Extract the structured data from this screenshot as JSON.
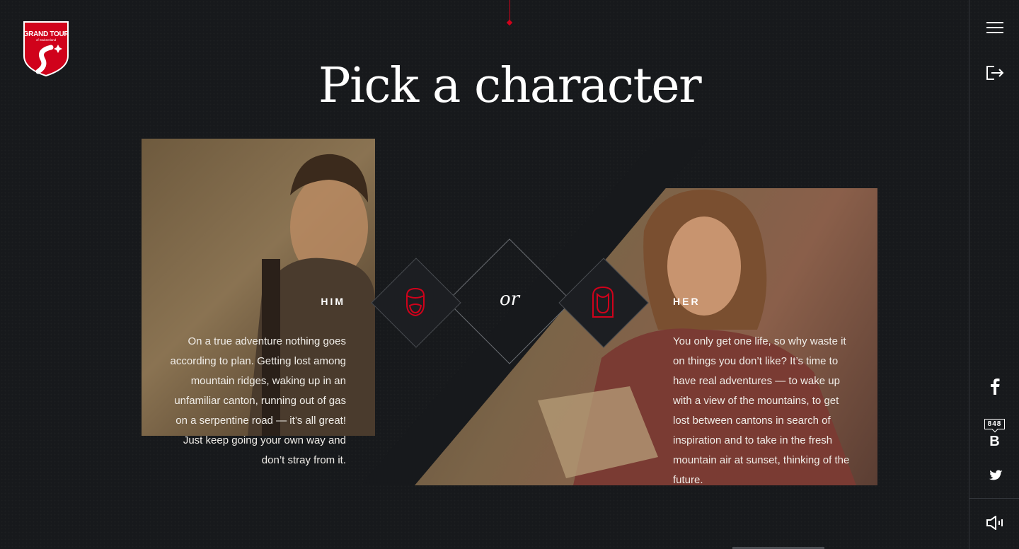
{
  "logo": {
    "line1": "GRAND TOUR",
    "line2": "of Switzerland",
    "color": "#d0021b"
  },
  "page_title": "Pick a character",
  "or_label": "or",
  "him": {
    "label": "HIM",
    "description": "On a true adventure nothing goes according to plan. Getting lost among mountain ridges, waking up in an unfamiliar canton, running out of gas on a serpentine road — it’s all great! Just keep going your own way and don’t stray from it.",
    "icon": "male-face-icon"
  },
  "her": {
    "label": "HER",
    "description": "You only get one life, so why waste it on things you don’t like? It’s time to have real adventures — to wake up with a view of the mountains, to get lost between cantons in search of inspiration and to take in the fresh mountain air at sunset, thinking of the future.",
    "icon": "female-face-icon"
  },
  "rail": {
    "menu_icon": "hamburger-menu-icon",
    "exit_icon": "exit-icon",
    "facebook_icon": "facebook-icon",
    "vk_count": "848",
    "vk_letter": "B",
    "twitter_icon": "twitter-icon",
    "sound_icon": "sound-icon"
  },
  "colors": {
    "accent": "#d0021b",
    "background": "#17191c"
  }
}
